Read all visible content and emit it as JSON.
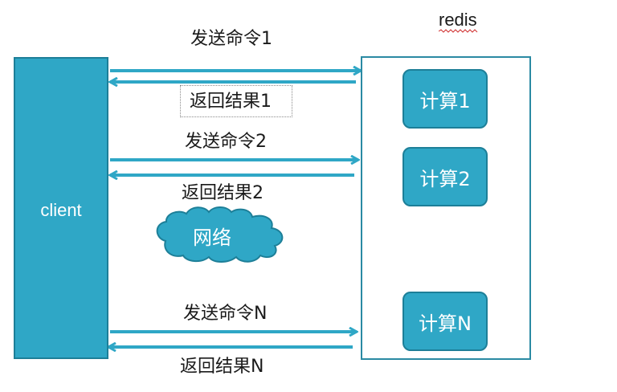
{
  "client": {
    "label": "client"
  },
  "server": {
    "title": "redis"
  },
  "computations": [
    {
      "label": "计算1"
    },
    {
      "label": "计算2"
    },
    {
      "label": "计算N"
    }
  ],
  "exchanges": [
    {
      "send": "发送命令1",
      "reply": "返回结果1"
    },
    {
      "send": "发送命令2",
      "reply": "返回结果2"
    },
    {
      "send": "发送命令N",
      "reply": "返回结果N"
    }
  ],
  "network": {
    "label": "网络"
  },
  "colors": {
    "accent": "#2fa7c6",
    "border": "#1d7f98",
    "arrow": "#2fa7c6"
  }
}
